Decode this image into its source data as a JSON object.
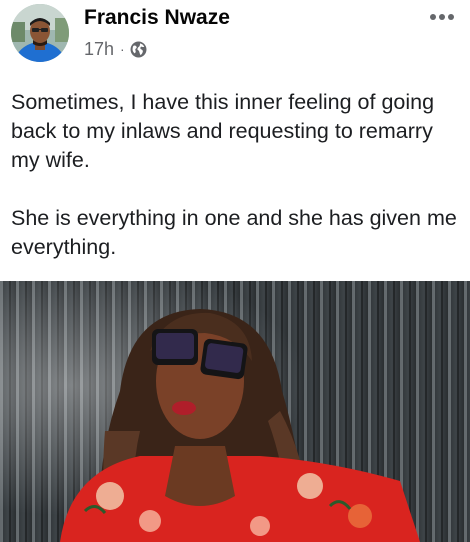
{
  "post": {
    "author_name": "Francis Nwaze",
    "timestamp": "17h",
    "separator": "·",
    "audience_icon": "globe-icon",
    "more_icon": "more-options-icon",
    "paragraphs": [
      "Sometimes, I have this inner feeling of going back to my inlaws and requesting to remarry my wife.",
      "She is everything in one and she has given me everything."
    ]
  },
  "colors": {
    "text_primary": "#1c1e21",
    "text_secondary": "#65676b",
    "background": "#ffffff"
  }
}
